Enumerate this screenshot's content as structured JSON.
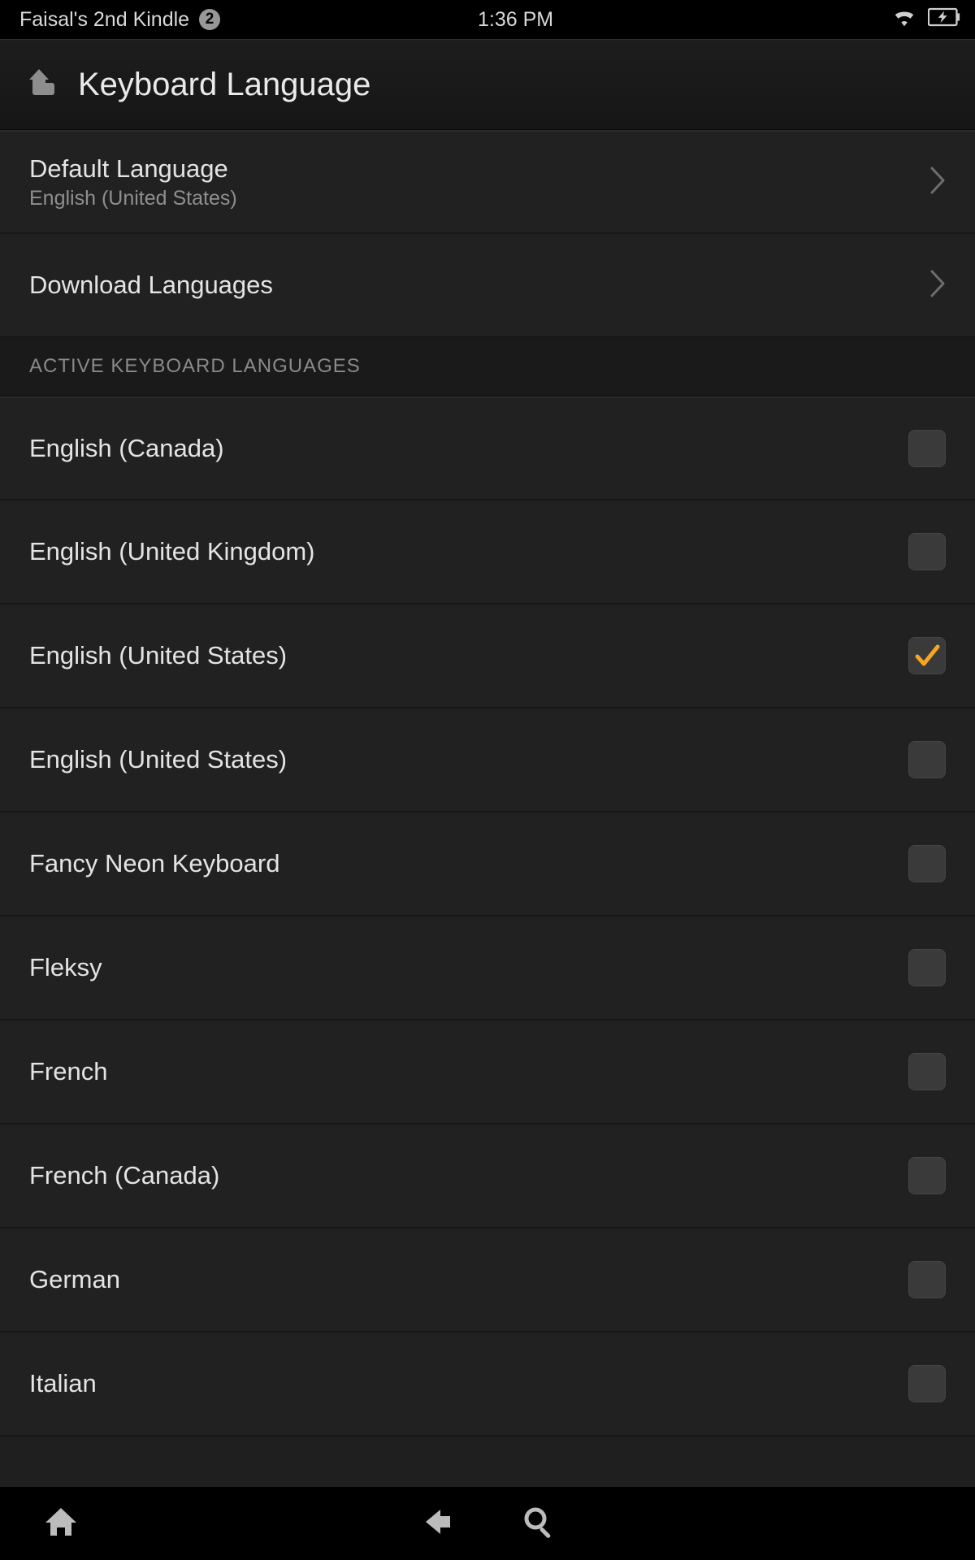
{
  "status": {
    "device_name": "Faisal's 2nd Kindle",
    "notification_count": "2",
    "time": "1:36 PM"
  },
  "header": {
    "title": "Keyboard Language"
  },
  "settings": {
    "default_language": {
      "label": "Default Language",
      "value": "English (United States)"
    },
    "download_languages": {
      "label": "Download Languages"
    }
  },
  "section": {
    "active_header": "ACTIVE KEYBOARD LANGUAGES"
  },
  "languages": [
    {
      "label": "English (Canada)",
      "checked": false
    },
    {
      "label": "English (United Kingdom)",
      "checked": false
    },
    {
      "label": "English (United States)",
      "checked": true
    },
    {
      "label": "English (United States)",
      "checked": false
    },
    {
      "label": "Fancy Neon Keyboard",
      "checked": false
    },
    {
      "label": "Fleksy",
      "checked": false
    },
    {
      "label": "French",
      "checked": false
    },
    {
      "label": "French (Canada)",
      "checked": false
    },
    {
      "label": "German",
      "checked": false
    },
    {
      "label": "Italian",
      "checked": false
    }
  ]
}
